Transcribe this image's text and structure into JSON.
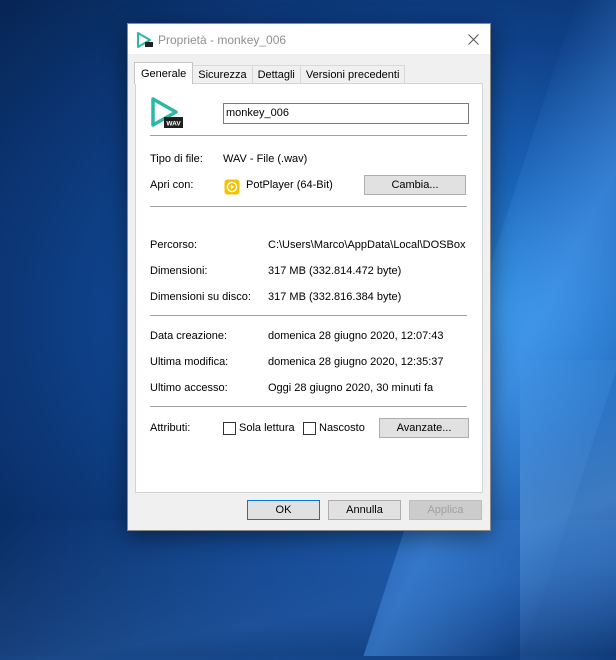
{
  "window": {
    "title": "Proprietà - monkey_006",
    "close_icon": "close-icon"
  },
  "tabs": [
    {
      "label": "Generale",
      "active": true
    },
    {
      "label": "Sicurezza",
      "active": false
    },
    {
      "label": "Dettagli",
      "active": false
    },
    {
      "label": "Versioni precedenti",
      "active": false
    }
  ],
  "general": {
    "file_icon": "wav-file-icon",
    "file_icon_badge": "WAV",
    "file_name": "monkey_006",
    "file_type_label": "Tipo di file:",
    "file_type_value": "WAV - File (.wav)",
    "open_with_label": "Apri con:",
    "open_with_icon": "potplayer-icon",
    "open_with_value": "PotPlayer (64-Bit)",
    "change_button": "Cambia...",
    "path_label": "Percorso:",
    "path_value": "C:\\Users\\Marco\\AppData\\Local\\DOSBox",
    "size_label": "Dimensioni:",
    "size_value": "317 MB (332.814.472 byte)",
    "disk_size_label": "Dimensioni su disco:",
    "disk_size_value": "317 MB (332.816.384 byte)",
    "created_label": "Data creazione:",
    "created_value": "domenica 28 giugno 2020, 12:07:43",
    "modified_label": "Ultima modifica:",
    "modified_value": "domenica 28 giugno 2020, 12:35:37",
    "accessed_label": "Ultimo accesso:",
    "accessed_value": "Oggi 28 giugno 2020, 30 minuti fa",
    "attributes_label": "Attributi:",
    "readonly_label": "Sola lettura",
    "readonly_checked": false,
    "hidden_label": "Nascosto",
    "hidden_checked": false,
    "advanced_button": "Avanzate..."
  },
  "footer": {
    "ok_button": "OK",
    "cancel_button": "Annulla",
    "apply_button": "Applica"
  },
  "colors": {
    "accent": "#0078d7",
    "icon_teal": "#2bb8a6",
    "potplayer_yellow": "#f3c200",
    "desktop_blue": "#1a63b8"
  }
}
